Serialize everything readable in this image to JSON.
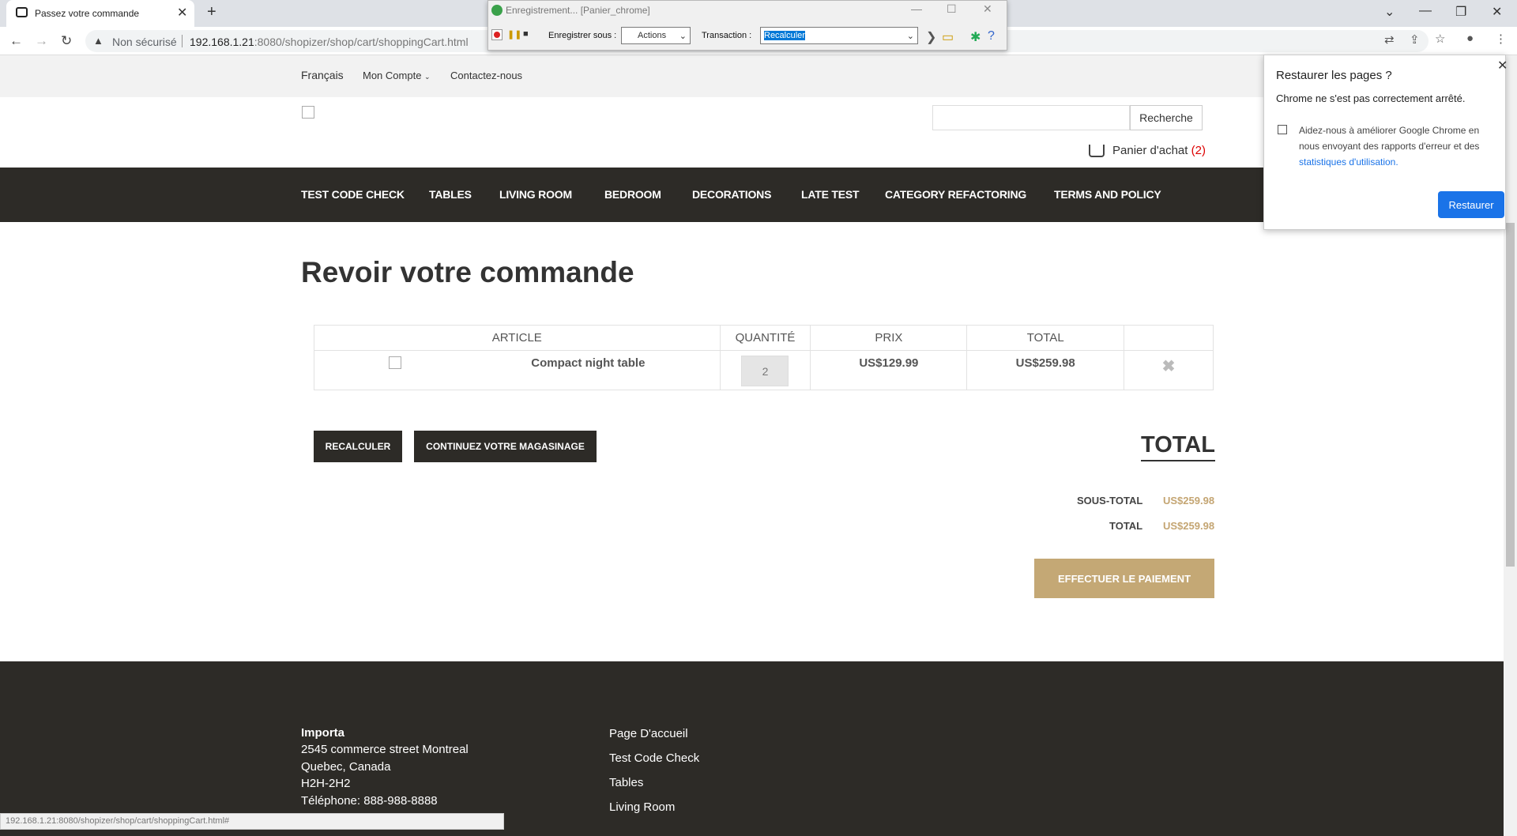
{
  "browser": {
    "tab_title": "Passez votre commande",
    "security_label": "Non sécurisé",
    "url_host": "192.168.1.21",
    "url_rest": ":8080/shopizer/shop/cart/shoppingCart.html",
    "status_url": "192.168.1.21:8080/shopizer/shop/cart/shoppingCart.html#"
  },
  "recorder": {
    "title": "Enregistrement... [Panier_chrome]",
    "save_label": "Enregistrer sous :",
    "save_value": "Actions",
    "transaction_label": "Transaction :",
    "transaction_value": "Recalculer"
  },
  "topbar": {
    "language": "Français",
    "account": "Mon Compte",
    "contact": "Contactez-nous"
  },
  "header": {
    "search_button": "Recherche",
    "cart_label": "Panier d'achat",
    "cart_count": "(2)"
  },
  "menu": [
    "TEST CODE CHECK",
    "TABLES",
    "LIVING ROOM",
    "BEDROOM",
    "DECORATIONS",
    "LATE TEST",
    "CATEGORY REFACTORING",
    "TERMS AND POLICY"
  ],
  "main": {
    "title": "Revoir votre commande",
    "columns": [
      "ARTICLE",
      "QUANTITÉ",
      "PRIX",
      "TOTAL"
    ],
    "item": {
      "name": "Compact night table",
      "qty": "2",
      "price": "US$129.99",
      "total": "US$259.98"
    },
    "recalc_button": "RECALCULER",
    "continue_button": "CONTINUEZ VOTRE MAGASINAGE",
    "total_heading": "TOTAL",
    "subtotal_label": "SOUS-TOTAL",
    "subtotal_value": "US$259.98",
    "total_label": "TOTAL",
    "total_value": "US$259.98",
    "pay_button": "EFFECTUER LE PAIEMENT"
  },
  "footer": {
    "company": "Importa",
    "address1": "2545 commerce street Montreal",
    "address2": "Quebec, Canada",
    "postal": "H2H-2H2",
    "phone_label": "Téléphone:",
    "phone": "888-988-8888",
    "links": [
      "Page D'accueil",
      "Test Code Check",
      "Tables",
      "Living Room"
    ]
  },
  "popup": {
    "title": "Restaurer les pages ?",
    "subtitle": "Chrome ne s'est pas correctement arrêté.",
    "checkbox_text": "Aidez-nous à améliorer Google Chrome en nous envoyant des rapports d'erreur et des",
    "link_text": "statistiques d'utilisation.",
    "button": "Restaurer"
  }
}
